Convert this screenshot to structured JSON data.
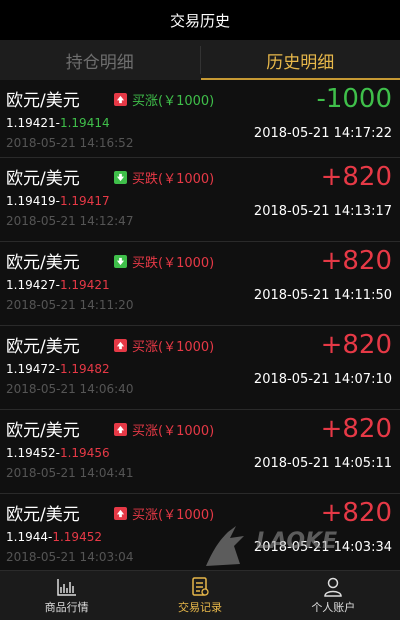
{
  "header": {
    "title": "交易历史"
  },
  "tabs": [
    {
      "label": "持仓明细",
      "active": false
    },
    {
      "label": "历史明细",
      "active": true
    }
  ],
  "records": [
    {
      "pair": "欧元/美元",
      "direction": "买涨",
      "amount": "(￥1000)",
      "direction_color": "green",
      "icon": "up-arrow-icon",
      "open": "1.19421",
      "close": "1.19414",
      "close_color": "green",
      "time_small": "2018-05-21 14:16:52",
      "pl": "-1000",
      "pl_color": "green",
      "time_big": "2018-05-21 14:17:22"
    },
    {
      "pair": "欧元/美元",
      "direction": "买跌",
      "amount": "(￥1000)",
      "direction_color": "red",
      "icon": "down-arrow-icon",
      "open": "1.19419",
      "close": "1.19417",
      "close_color": "red",
      "time_small": "2018-05-21 14:12:47",
      "pl": "+820",
      "pl_color": "red",
      "time_big": "2018-05-21 14:13:17"
    },
    {
      "pair": "欧元/美元",
      "direction": "买跌",
      "amount": "(￥1000)",
      "direction_color": "red",
      "icon": "down-arrow-icon",
      "open": "1.19427",
      "close": "1.19421",
      "close_color": "red",
      "time_small": "2018-05-21 14:11:20",
      "pl": "+820",
      "pl_color": "red",
      "time_big": "2018-05-21 14:11:50"
    },
    {
      "pair": "欧元/美元",
      "direction": "买涨",
      "amount": "(￥1000)",
      "direction_color": "red",
      "icon": "up-arrow-icon",
      "open": "1.19472",
      "close": "1.19482",
      "close_color": "red",
      "time_small": "2018-05-21 14:06:40",
      "pl": "+820",
      "pl_color": "red",
      "time_big": "2018-05-21 14:07:10"
    },
    {
      "pair": "欧元/美元",
      "direction": "买涨",
      "amount": "(￥1000)",
      "direction_color": "red",
      "icon": "up-arrow-icon",
      "open": "1.19452",
      "close": "1.19456",
      "close_color": "red",
      "time_small": "2018-05-21 14:04:41",
      "pl": "+820",
      "pl_color": "red",
      "time_big": "2018-05-21 14:05:11"
    },
    {
      "pair": "欧元/美元",
      "direction": "买涨",
      "amount": "(￥1000)",
      "direction_color": "red",
      "icon": "up-arrow-icon",
      "open": "1.1944",
      "close": "1.19452",
      "close_color": "red",
      "time_small": "2018-05-21 14:03:04",
      "pl": "+820",
      "pl_color": "red",
      "time_big": "2018-05-21 14:03:34"
    }
  ],
  "watermark": {
    "text": "LAOKE"
  },
  "footer": {
    "items": [
      {
        "label": "商品行情",
        "icon": "chart-icon",
        "active": false
      },
      {
        "label": "交易记录",
        "icon": "records-icon",
        "active": true
      },
      {
        "label": "个人账户",
        "icon": "user-icon",
        "active": false
      }
    ]
  },
  "colors": {
    "accent": "#e8b84a",
    "up": "#e63946",
    "down": "#3fbf4a"
  }
}
